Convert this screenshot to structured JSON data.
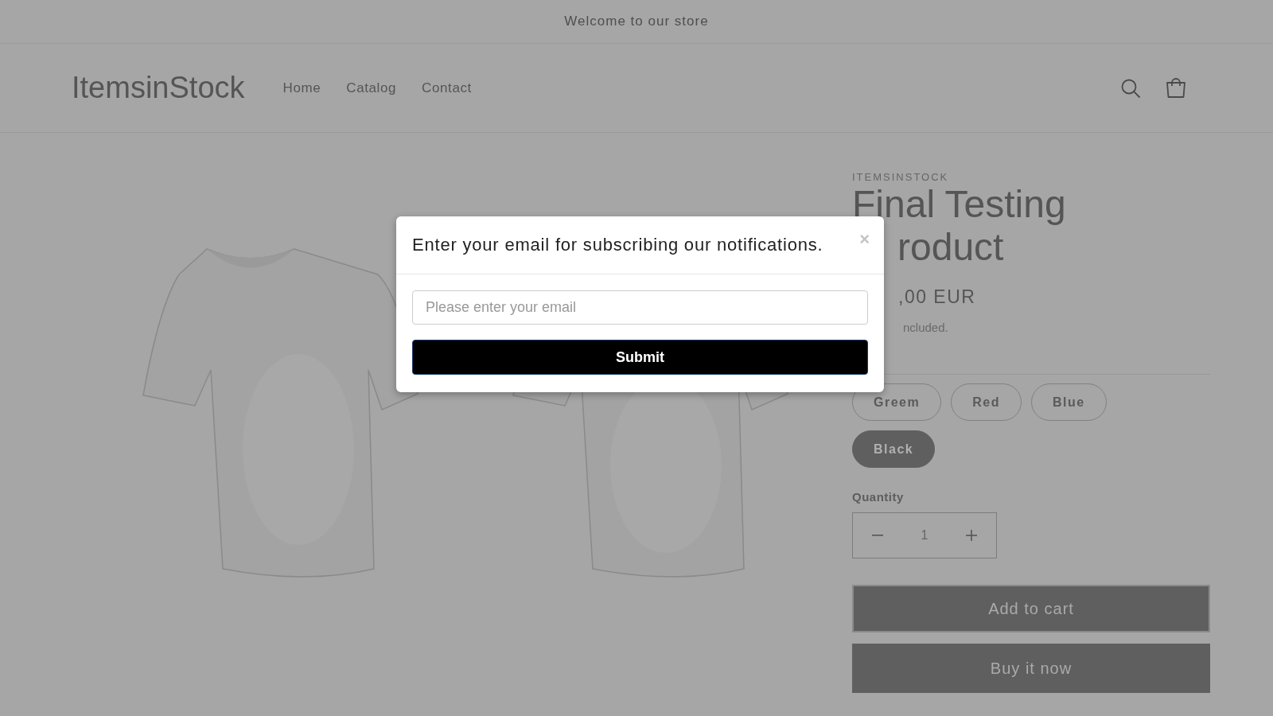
{
  "announcement": "Welcome to our store",
  "header": {
    "logo": "ItemsinStock",
    "nav": [
      {
        "label": "Home"
      },
      {
        "label": "Catalog"
      },
      {
        "label": "Contact"
      }
    ]
  },
  "product": {
    "vendor": "ITEMSINSTOCK",
    "title_lines": [
      "Final Testing",
      "roduct"
    ],
    "price": ",00 EUR",
    "tax_note": "ncluded.",
    "variants": [
      {
        "label": "Greem",
        "selected": false
      },
      {
        "label": "Red",
        "selected": false
      },
      {
        "label": "Blue",
        "selected": false
      },
      {
        "label": "Black",
        "selected": true
      }
    ],
    "quantity": {
      "label": "Quantity",
      "value": "1"
    },
    "buttons": [
      "Add to cart",
      "Buy it now"
    ]
  },
  "modal": {
    "title": "Enter your email for subscribing our notifications.",
    "close": "×",
    "placeholder": "Please enter your email",
    "submit": "Submit"
  }
}
